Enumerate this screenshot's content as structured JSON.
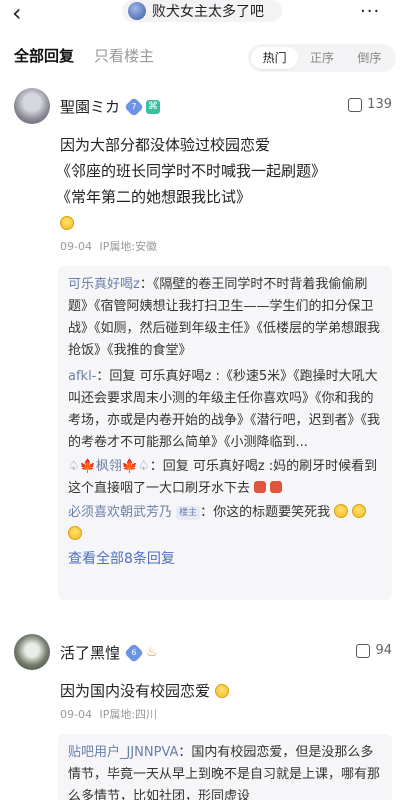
{
  "header": {
    "back_icon": "chevron-left-icon",
    "title": "败犬女主太多了吧",
    "more_icon": "more-horizontal-icon"
  },
  "tabs": {
    "all": "全部回复",
    "owner_only": "只看楼主",
    "sort_options": [
      "热门",
      "正序",
      "倒序"
    ],
    "active_sort": "热门"
  },
  "posts": [
    {
      "user": "聖園ミカ",
      "level": "7",
      "likes": "139",
      "lines": [
        "因为大部分都没体验过校园恋爱",
        "《邻座的班长同学时不时喊我一起刷题》",
        "《常年第二的她想跟我比试》"
      ],
      "date": "09-04",
      "ip": "IP属地:安徽",
      "replies": [
        {
          "name": "可乐真好喝z",
          "text": "：《隔壁的卷王同学时不时背着我偷偷刷题》《宿管阿姨想让我打扫卫生——学生们的扣分保卫战》《如厕，然后碰到年级主任》《低楼层的学弟想跟我抢饭》《我推的食堂》"
        },
        {
          "name": "afkl-",
          "text": "：回复 可乐真好喝z :《秒速5米》《跑操时大吼大叫还会要求周末小测的年级主任你喜欢吗》《你和我的考场，亦或是内卷开始的战争》《潜行吧，迟到者》《我的考卷才不可能那么简单》《小测降临到..."
        },
        {
          "name": "♤🍁枫翎🍁♤",
          "text": "：回复 可乐真好喝z :妈的刷牙时候看到这个直接咽了一大口刷牙水下去"
        },
        {
          "name": "必须喜欢朝武芳乃",
          "tag": "楼主",
          "text": "：你这的标题要笑死我"
        }
      ],
      "view_all": "查看全部8条回复"
    },
    {
      "user": "活了黑惶",
      "likes": "94",
      "lines": [
        "因为国内没有校园恋爱"
      ],
      "date": "09-04",
      "ip": "IP属地:四川",
      "replies": [
        {
          "name": "贴吧用户_JJNNPVA",
          "text": "：国内有校园恋爱，但是没那么多情节，毕竟一天从早上到晚不是自习就是上课，哪有那么多情节，比如社团，形同虚设"
        }
      ]
    }
  ]
}
